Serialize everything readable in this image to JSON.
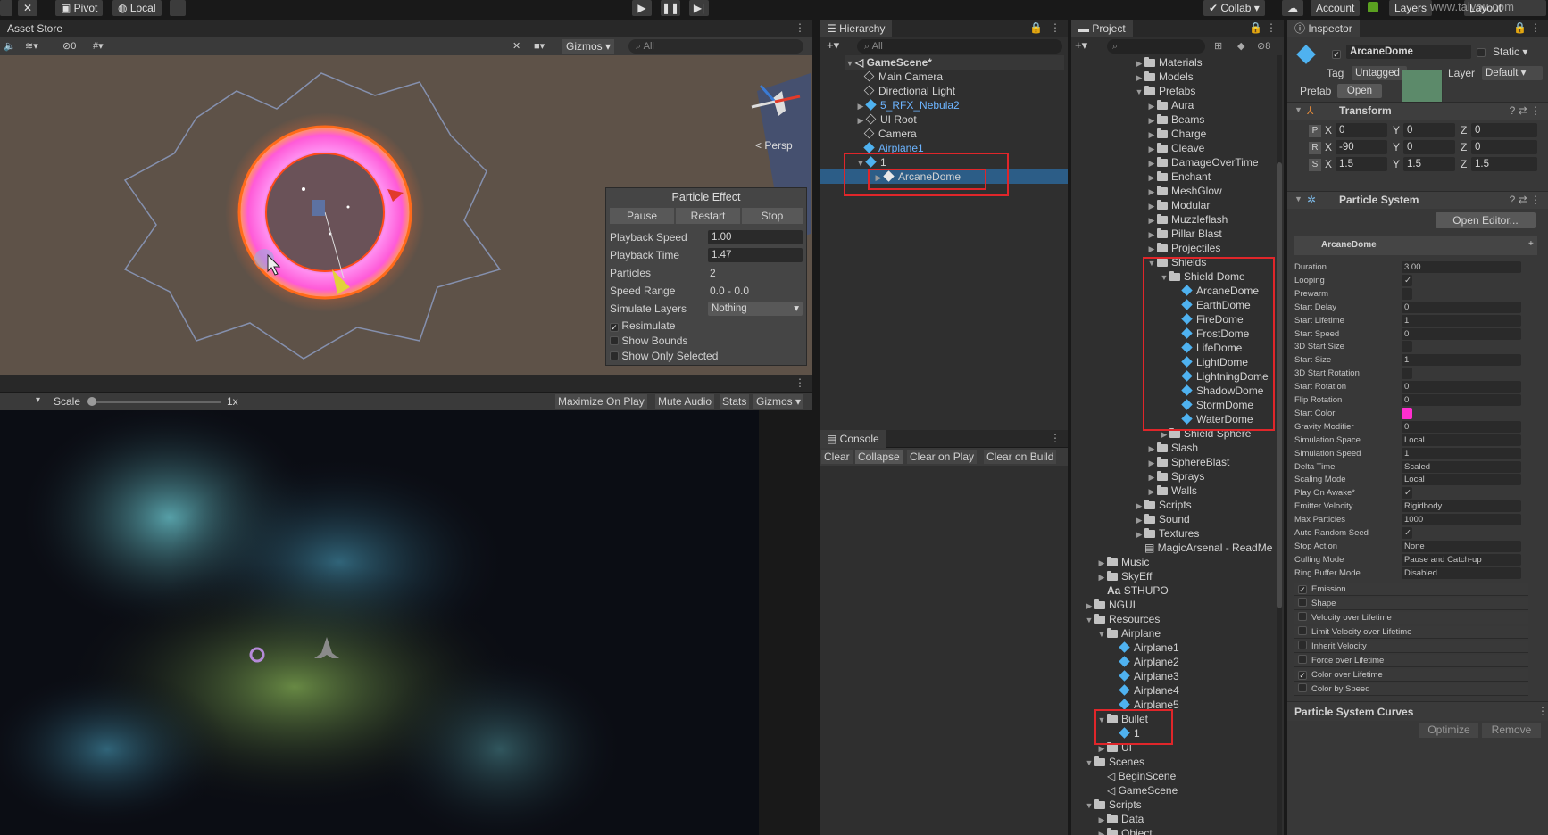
{
  "toolbar": {
    "pivot": "Pivot",
    "local": "Local",
    "collab": "Collab",
    "account": "Account",
    "layers": "Layers",
    "layout": "Layout",
    "watermark": "www.taiyou.com"
  },
  "scene": {
    "tab": "Asset Store",
    "gizmos": "Gizmos",
    "search": "All",
    "persp": "< Persp",
    "count": "0"
  },
  "particle_effect": {
    "title": "Particle Effect",
    "pause": "Pause",
    "restart": "Restart",
    "stop": "Stop",
    "rows": [
      {
        "label": "Playback Speed",
        "value": "1.00"
      },
      {
        "label": "Playback Time",
        "value": "1.47"
      },
      {
        "label": "Particles",
        "value": "2"
      },
      {
        "label": "Speed Range",
        "value": "0.0 - 0.0"
      },
      {
        "label": "Simulate Layers",
        "value": "Nothing"
      }
    ],
    "resimulate": "Resimulate",
    "show_bounds": "Show Bounds",
    "show_only_selected": "Show Only Selected"
  },
  "game": {
    "scale": "Scale",
    "scale_val": "1x",
    "maximize": "Maximize On Play",
    "mute": "Mute Audio",
    "stats": "Stats",
    "gizmos": "Gizmos"
  },
  "hierarchy": {
    "tab": "Hierarchy",
    "search": "All",
    "items": [
      "GameScene*",
      "Main Camera",
      "Directional Light",
      "5_RFX_Nebula2",
      "UI Root",
      "Camera",
      "Airplane1",
      "1",
      "ArcaneDome"
    ]
  },
  "console": {
    "tab": "Console",
    "clear": "Clear",
    "collapse": "Collapse",
    "clear_on_play": "Clear on Play",
    "clear_on_build": "Clear on Build"
  },
  "project": {
    "tab": "Project",
    "count": "8",
    "items": [
      "Materials",
      "Models",
      "Prefabs",
      "Aura",
      "Beams",
      "Charge",
      "Cleave",
      "DamageOverTime",
      "Enchant",
      "MeshGlow",
      "Modular",
      "Muzzleflash",
      "Pillar Blast",
      "Projectiles",
      "Shields",
      "Shield Dome",
      "ArcaneDome",
      "EarthDome",
      "FireDome",
      "FrostDome",
      "LifeDome",
      "LightDome",
      "LightningDome",
      "ShadowDome",
      "StormDome",
      "WaterDome",
      "Shield Sphere",
      "Slash",
      "SphereBlast",
      "Sprays",
      "Walls",
      "Scripts",
      "Sound",
      "Textures",
      "MagicArsenal - ReadMe",
      "Music",
      "SkyEff",
      "STHUPO",
      "NGUI",
      "Resources",
      "Airplane",
      "Airplane1",
      "Airplane2",
      "Airplane3",
      "Airplane4",
      "Airplane5",
      "Bullet",
      "1",
      "UI",
      "Scenes",
      "BeginScene",
      "GameScene",
      "Scripts",
      "Data",
      "Object"
    ]
  },
  "inspector": {
    "tab": "Inspector",
    "name": "ArcaneDome",
    "static": "Static",
    "tag_label": "Tag",
    "tag": "Untagged",
    "layer_label": "Layer",
    "layer": "Default",
    "prefab_label": "Prefab",
    "open": "Open",
    "transform": "Transform",
    "pos": {
      "l": "P",
      "x": "0",
      "y": "0",
      "z": "0"
    },
    "rot": {
      "l": "R",
      "x": "-90",
      "y": "0",
      "z": "0"
    },
    "scl": {
      "l": "S",
      "x": "1.5",
      "y": "1.5",
      "z": "1.5"
    },
    "ps_title": "Particle System",
    "open_editor": "Open Editor...",
    "ps_name": "ArcaneDome",
    "props": [
      [
        "Duration",
        "3.00"
      ],
      [
        "Looping",
        "✓"
      ],
      [
        "Prewarm",
        ""
      ],
      [
        "Start Delay",
        "0"
      ],
      [
        "Start Lifetime",
        "1"
      ],
      [
        "Start Speed",
        "0"
      ],
      [
        "3D Start Size",
        ""
      ],
      [
        "Start Size",
        "1"
      ],
      [
        "3D Start Rotation",
        ""
      ],
      [
        "Start Rotation",
        "0"
      ],
      [
        "Flip Rotation",
        "0"
      ],
      [
        "Start Color",
        ""
      ],
      [
        "Gravity Modifier",
        "0"
      ],
      [
        "Simulation Space",
        "Local"
      ],
      [
        "Simulation Speed",
        "1"
      ],
      [
        "Delta Time",
        "Scaled"
      ],
      [
        "Scaling Mode",
        "Local"
      ],
      [
        "Play On Awake*",
        "✓"
      ],
      [
        "Emitter Velocity",
        "Rigidbody"
      ],
      [
        "Max Particles",
        "1000"
      ],
      [
        "Auto Random Seed",
        "✓"
      ],
      [
        "Stop Action",
        "None"
      ],
      [
        "Culling Mode",
        "Pause and Catch-up"
      ],
      [
        "Ring Buffer Mode",
        "Disabled"
      ]
    ],
    "modules": [
      [
        "Emission",
        "✓"
      ],
      [
        "Shape",
        ""
      ],
      [
        "Velocity over Lifetime",
        ""
      ],
      [
        "Limit Velocity over Lifetime",
        ""
      ],
      [
        "Inherit Velocity",
        ""
      ],
      [
        "Force over Lifetime",
        ""
      ],
      [
        "Color over Lifetime",
        "✓"
      ],
      [
        "Color by Speed",
        ""
      ]
    ],
    "curves": "Particle System Curves",
    "optimize": "Optimize",
    "remove": "Remove",
    "start_color": "#ff2ecf"
  }
}
